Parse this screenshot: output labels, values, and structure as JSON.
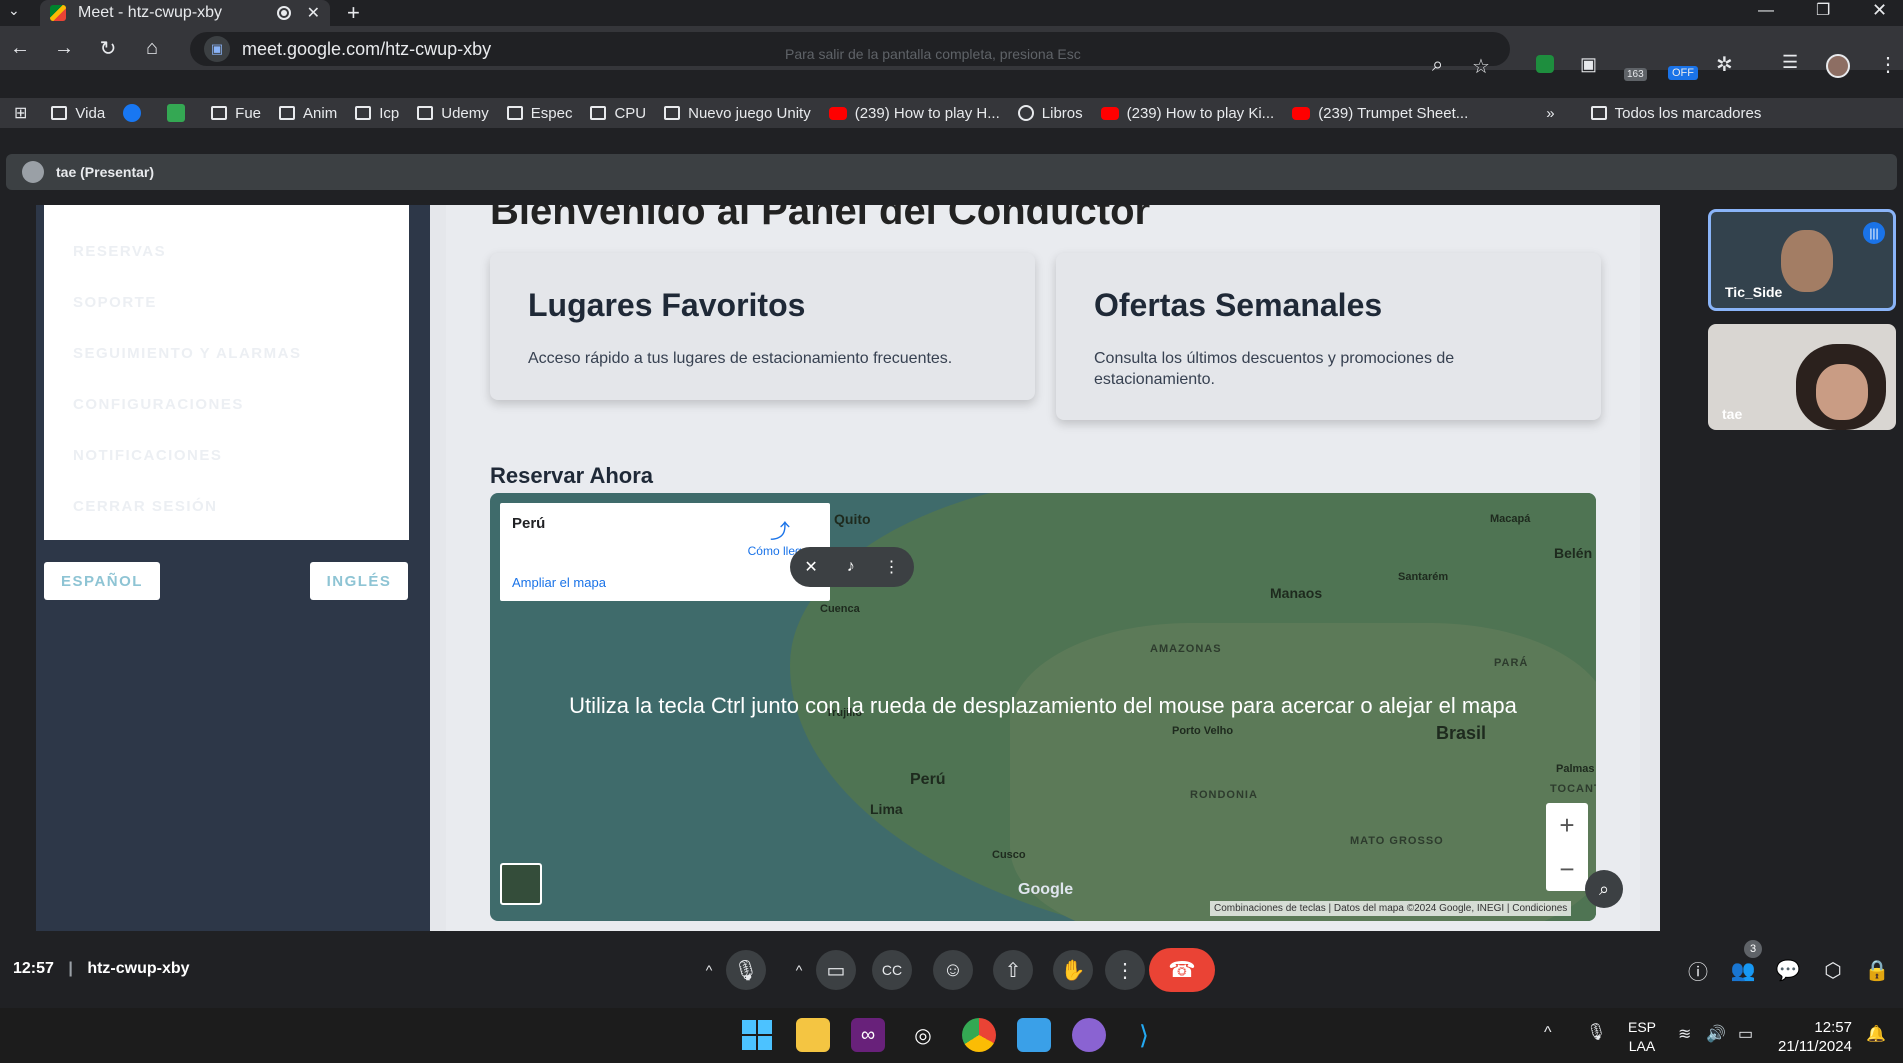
{
  "browser": {
    "tab_title": "Meet - htz-cwup-xby",
    "url": "meet.google.com/htz-cwup-xby",
    "fullscreen_hint": "Para salir de la pantalla completa, presiona Esc",
    "extension_badges": [
      "163",
      "OFF"
    ],
    "bookmarks": [
      {
        "label": "Vida",
        "icon": "folder-icon"
      },
      {
        "label": "",
        "icon": "facebook-icon"
      },
      {
        "label": "",
        "icon": "px-icon"
      },
      {
        "label": "Fue",
        "icon": "folder-icon"
      },
      {
        "label": "Anim",
        "icon": "folder-icon"
      },
      {
        "label": "Icp",
        "icon": "folder-icon"
      },
      {
        "label": "Udemy",
        "icon": "folder-icon"
      },
      {
        "label": "Espec",
        "icon": "folder-icon"
      },
      {
        "label": "CPU",
        "icon": "folder-icon"
      },
      {
        "label": "Nuevo juego Unity",
        "icon": "folder-icon"
      },
      {
        "label": "(239) How to play H...",
        "icon": "youtube-icon"
      },
      {
        "label": "Libros",
        "icon": "globe-icon"
      },
      {
        "label": "(239) How to play Ki...",
        "icon": "youtube-icon"
      },
      {
        "label": "(239) Trumpet Sheet...",
        "icon": "youtube-icon"
      }
    ],
    "all_bookmarks": "Todos los marcadores"
  },
  "meet": {
    "presenter_label": "tae (Presentar)",
    "time": "12:57",
    "separator": "|",
    "meeting_code": "htz-cwup-xby",
    "people_count": "3",
    "participants": [
      {
        "name": "Tic_Side",
        "speaking": true
      },
      {
        "name": "tae",
        "speaking": false
      }
    ]
  },
  "app": {
    "menu": [
      "RESERVAS",
      "SOPORTE",
      "SEGUIMIENTO Y ALARMAS",
      "CONFIGURACIONES",
      "NOTIFICACIONES",
      "CERRAR SESIÓN"
    ],
    "lang_es": "ESPAÑOL",
    "lang_en": "INGLÉS",
    "welcome": "Bienvenido al Panel del Conductor",
    "cards": [
      {
        "title": "Lugares Favoritos",
        "text": "Acceso rápido a tus lugares de estacionamiento frecuentes."
      },
      {
        "title": "Ofertas Semanales",
        "text": "Consulta los últimos descuentos y promociones de estacionamiento."
      }
    ],
    "reserve_title": "Reservar Ahora",
    "map": {
      "place": "Perú",
      "directions": "Cómo llegar",
      "enlarge": "Ampliar el mapa",
      "overlay": "Utiliza la tecla Ctrl junto con la rueda de desplazamiento del mouse para acercar o alejar el mapa",
      "footer": "Combinaciones de teclas | Datos del mapa ©2024 Google, INEGI | Condiciones",
      "google": "Google",
      "labels": {
        "quito": "Quito",
        "cuenca": "Cuenca",
        "trujillo": "Trujillo",
        "lima": "Lima",
        "cusco": "Cusco",
        "peru": "Perú",
        "manaos": "Manaos",
        "belen": "Belén",
        "santarem": "Santarém",
        "macapa": "Macapá",
        "amazonas": "AMAZONAS",
        "para": "PARÁ",
        "porto_velho": "Porto Velho",
        "rondonia": "RONDONIA",
        "brasil": "Brasil",
        "mato_grosso": "MATO GROSSO",
        "palmas": "Palmas",
        "tocant": "TOCANT"
      }
    }
  },
  "taskbar": {
    "lang_top": "ESP",
    "lang_bottom": "LAA",
    "time": "12:57",
    "date": "21/11/2024"
  },
  "colors": {
    "end_call": "#ea4335",
    "accent": "#8ab4f8"
  }
}
